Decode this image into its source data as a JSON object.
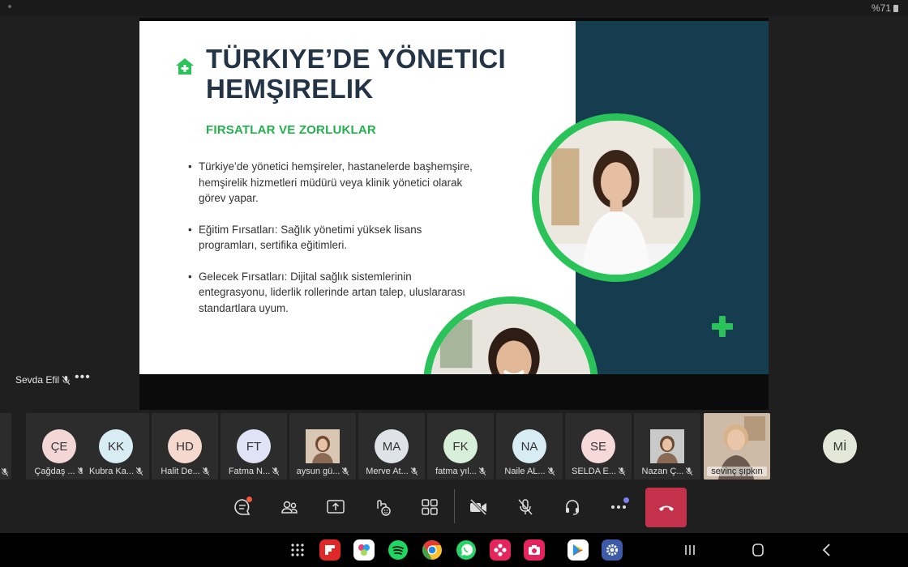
{
  "status": {
    "battery": "%71"
  },
  "slide": {
    "title": "TÜRKIYE’DE YÖNETICI HEMŞIRELIK",
    "subtitle": "FIRSATLAR VE ZORLUKLAR",
    "bullets": [
      "Türkiye’de yönetici hemşireler, hastanelerde başhemşire, hemşirelik hizmetleri müdürü veya klinik yönetici olarak görev yapar.",
      "Eğitim Fırsatları: Sağlık yönetimi yüksek lisans programları, sertifika eğitimleri.",
      "Gelecek Fırsatları: Dijital sağlık sistemlerinin entegrasyonu, liderlik rollerinde artan talep, uluslararası standartlara uyum."
    ],
    "colors": {
      "accent": "#29c35a",
      "title": "#243447",
      "panel": "#153c4f"
    }
  },
  "presenter": {
    "name": "Sevda Efil",
    "more": "•••"
  },
  "participants": [
    {
      "initials": "ÇE",
      "name": "Çağdaş ...",
      "color": "#f3d6d6"
    },
    {
      "initials": "KK",
      "name": "Kubra Ka...",
      "color": "#d7ecf3"
    },
    {
      "initials": "HD",
      "name": "Halit De...",
      "color": "#f5d9ce"
    },
    {
      "initials": "FT",
      "name": "Fatma N...",
      "color": "#dfe3f5"
    },
    {
      "initials": "",
      "name": "aysun gü...",
      "color": "#d9c6b3"
    },
    {
      "initials": "MA",
      "name": "Merve At...",
      "color": "#dfe3e8"
    },
    {
      "initials": "FK",
      "name": "fatma yıl...",
      "color": "#d8f0d9"
    },
    {
      "initials": "NA",
      "name": "Naile AL...",
      "color": "#d7ecf3"
    },
    {
      "initials": "SE",
      "name": "SELDA E...",
      "color": "#f6dada"
    },
    {
      "initials": "",
      "name": "Nazan Ç...",
      "color": "#c9c9c9"
    },
    {
      "initials": "",
      "name": "sevinç şıpkın",
      "color": "#c9b8a6"
    },
    {
      "initials": "Mİ",
      "name": "",
      "color": "#e3e8d9"
    }
  ],
  "toolbar": {
    "icons": [
      "chat-icon",
      "people-icon",
      "share-screen-icon",
      "reactions-icon",
      "view-grid-icon",
      "camera-off-icon",
      "mic-off-icon",
      "headset-icon",
      "more-icon",
      "end-call-icon"
    ],
    "colors": {
      "end": "#c4314b",
      "chat_badge": "#f15a3b",
      "more_badge": "#7b83eb"
    }
  },
  "navbar": {
    "apps": [
      "flipboard-icon",
      "gallery-icon",
      "spotify-icon",
      "chrome-icon",
      "whatsapp-icon",
      "bixby-icon",
      "camera-icon",
      "play-store-icon",
      "settings-icon"
    ]
  }
}
